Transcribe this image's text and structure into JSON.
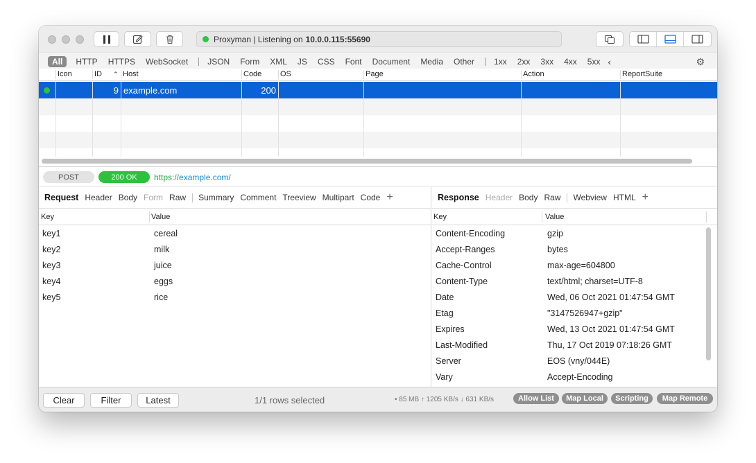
{
  "address_bar": {
    "text": "Proxyman | Listening on",
    "host": "10.0.0.115:55690"
  },
  "filters": {
    "types": [
      "All",
      "HTTP",
      "HTTPS",
      "WebSocket",
      "JSON",
      "Form",
      "XML",
      "JS",
      "CSS",
      "Font",
      "Document",
      "Media",
      "Other"
    ],
    "status_codes": [
      "1xx",
      "2xx",
      "3xx",
      "4xx",
      "5xx"
    ],
    "active": "All"
  },
  "table": {
    "columns": [
      "Icon",
      "ID",
      "Host",
      "Code",
      "OS",
      "Page",
      "Action",
      "ReportSuite"
    ],
    "row": {
      "id": "9",
      "host": "example.com",
      "code": "200"
    }
  },
  "request_line": {
    "method": "POST",
    "status": "200 OK",
    "url_scheme": "https://",
    "url_host": "example.com/"
  },
  "request": {
    "title": "Request",
    "tabs": [
      "Header",
      "Body",
      "Form",
      "Raw",
      "Summary",
      "Comment",
      "Treeview",
      "Multipart",
      "Code"
    ],
    "key_header": "Key",
    "value_header": "Value",
    "rows": [
      {
        "key": "key1",
        "value": "cereal"
      },
      {
        "key": "key2",
        "value": "milk"
      },
      {
        "key": "key3",
        "value": "juice"
      },
      {
        "key": "key4",
        "value": "eggs"
      },
      {
        "key": "key5",
        "value": "rice"
      }
    ]
  },
  "response": {
    "title": "Response",
    "tabs": [
      "Header",
      "Body",
      "Raw",
      "Webview",
      "HTML"
    ],
    "key_header": "Key",
    "value_header": "Value",
    "rows": [
      {
        "key": "Content-Encoding",
        "value": "gzip"
      },
      {
        "key": "Accept-Ranges",
        "value": "bytes"
      },
      {
        "key": "Cache-Control",
        "value": "max-age=604800"
      },
      {
        "key": "Content-Type",
        "value": "text/html; charset=UTF-8"
      },
      {
        "key": "Date",
        "value": "Wed, 06 Oct 2021 01:47:54 GMT"
      },
      {
        "key": "Etag",
        "value": "\"3147526947+gzip\""
      },
      {
        "key": "Expires",
        "value": "Wed, 13 Oct 2021 01:47:54 GMT"
      },
      {
        "key": "Last-Modified",
        "value": "Thu, 17 Oct 2019 07:18:26 GMT"
      },
      {
        "key": "Server",
        "value": "EOS (vny/044E)"
      },
      {
        "key": "Vary",
        "value": "Accept-Encoding"
      }
    ]
  },
  "footer": {
    "clear": "Clear",
    "filter": "Filter",
    "latest": "Latest",
    "selection": "1/1 rows selected",
    "stats": "• 85 MB ↑ 1205 KB/s ↓ 631 KB/s",
    "badges": [
      "Allow List",
      "Map Local",
      "Scripting",
      "Map Remote"
    ]
  },
  "colors": {
    "selection": "#0a62d6",
    "status_ok": "#2cc23f",
    "listening": "#28c840",
    "url_host": "#1a87e6"
  }
}
